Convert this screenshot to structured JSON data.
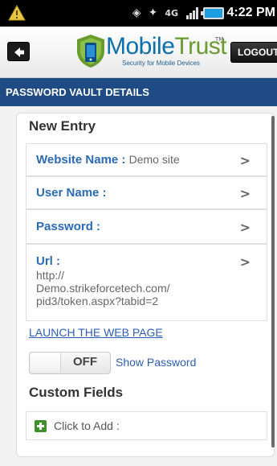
{
  "status_bar": {
    "notification_icon": "warning-triangle-icon",
    "icons": [
      "signal-sound-icon",
      "bluetooth-icon",
      "4g-lte-icon",
      "cell-signal-icon"
    ],
    "network_label": "4G",
    "battery_color": "#1e9de0",
    "time": "4:22 PM"
  },
  "header": {
    "back_icon": "back-arrow-icon",
    "logo_text_part1": "Mobile",
    "logo_text_part2": "Trust",
    "logo_tm": "TM",
    "logo_tagline": "Security for Mobile Devices",
    "logout_label": "LOGOUT"
  },
  "title_bar": {
    "title": "PASSWORD VAULT DETAILS",
    "background": "#1f4b85"
  },
  "entry": {
    "section_title": "New Entry",
    "fields": [
      {
        "label": "Website Name :",
        "value": "Demo site"
      },
      {
        "label": "User Name :",
        "value": ""
      },
      {
        "label": "Password :",
        "value": ""
      },
      {
        "label": "Url :",
        "value": "http://\nDemo.strikeforcetech.com/\npid3/token.aspx?tabid=2"
      }
    ],
    "chevron": ">",
    "launch_link": "LAUNCH THE WEB PAGE",
    "toggle_state": "OFF",
    "show_password_label": "Show Password"
  },
  "custom_fields": {
    "section_title": "Custom Fields",
    "add_label": "Click to Add :"
  }
}
